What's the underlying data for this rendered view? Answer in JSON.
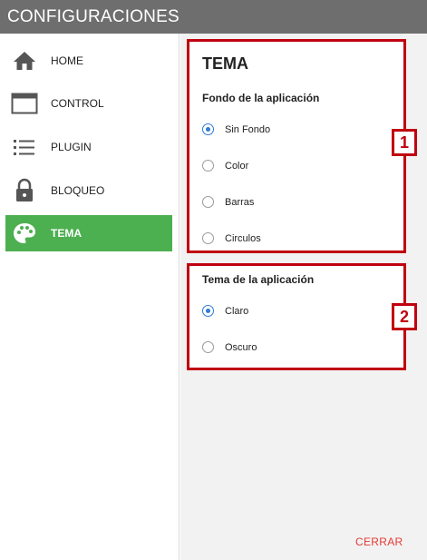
{
  "window": {
    "title": "CONFIGURACIONES"
  },
  "sidebar": {
    "items": [
      {
        "label": "HOME",
        "icon": "home-icon"
      },
      {
        "label": "CONTROL",
        "icon": "window-icon"
      },
      {
        "label": "PLUGIN",
        "icon": "list-icon"
      },
      {
        "label": "BLOQUEO",
        "icon": "lock-icon"
      },
      {
        "label": "TEMA",
        "icon": "palette-icon",
        "active": true
      }
    ]
  },
  "main": {
    "heading": "TEMA",
    "background_section": {
      "title": "Fondo de la aplicación",
      "options": [
        "Sin Fondo",
        "Color",
        "Barras",
        "Circulos"
      ],
      "selected": "Sin Fondo"
    },
    "theme_section": {
      "title": "Tema de la aplicación",
      "options": [
        "Claro",
        "Oscuro"
      ],
      "selected": "Claro"
    },
    "annotations": [
      "1",
      "2"
    ],
    "close_label": "CERRAR"
  },
  "colors": {
    "titlebar": "#6e6e6e",
    "active_nav": "#4caf50",
    "radio_selected": "#2e7bd6",
    "annotation": "#c00010",
    "close_text": "#e53935"
  }
}
